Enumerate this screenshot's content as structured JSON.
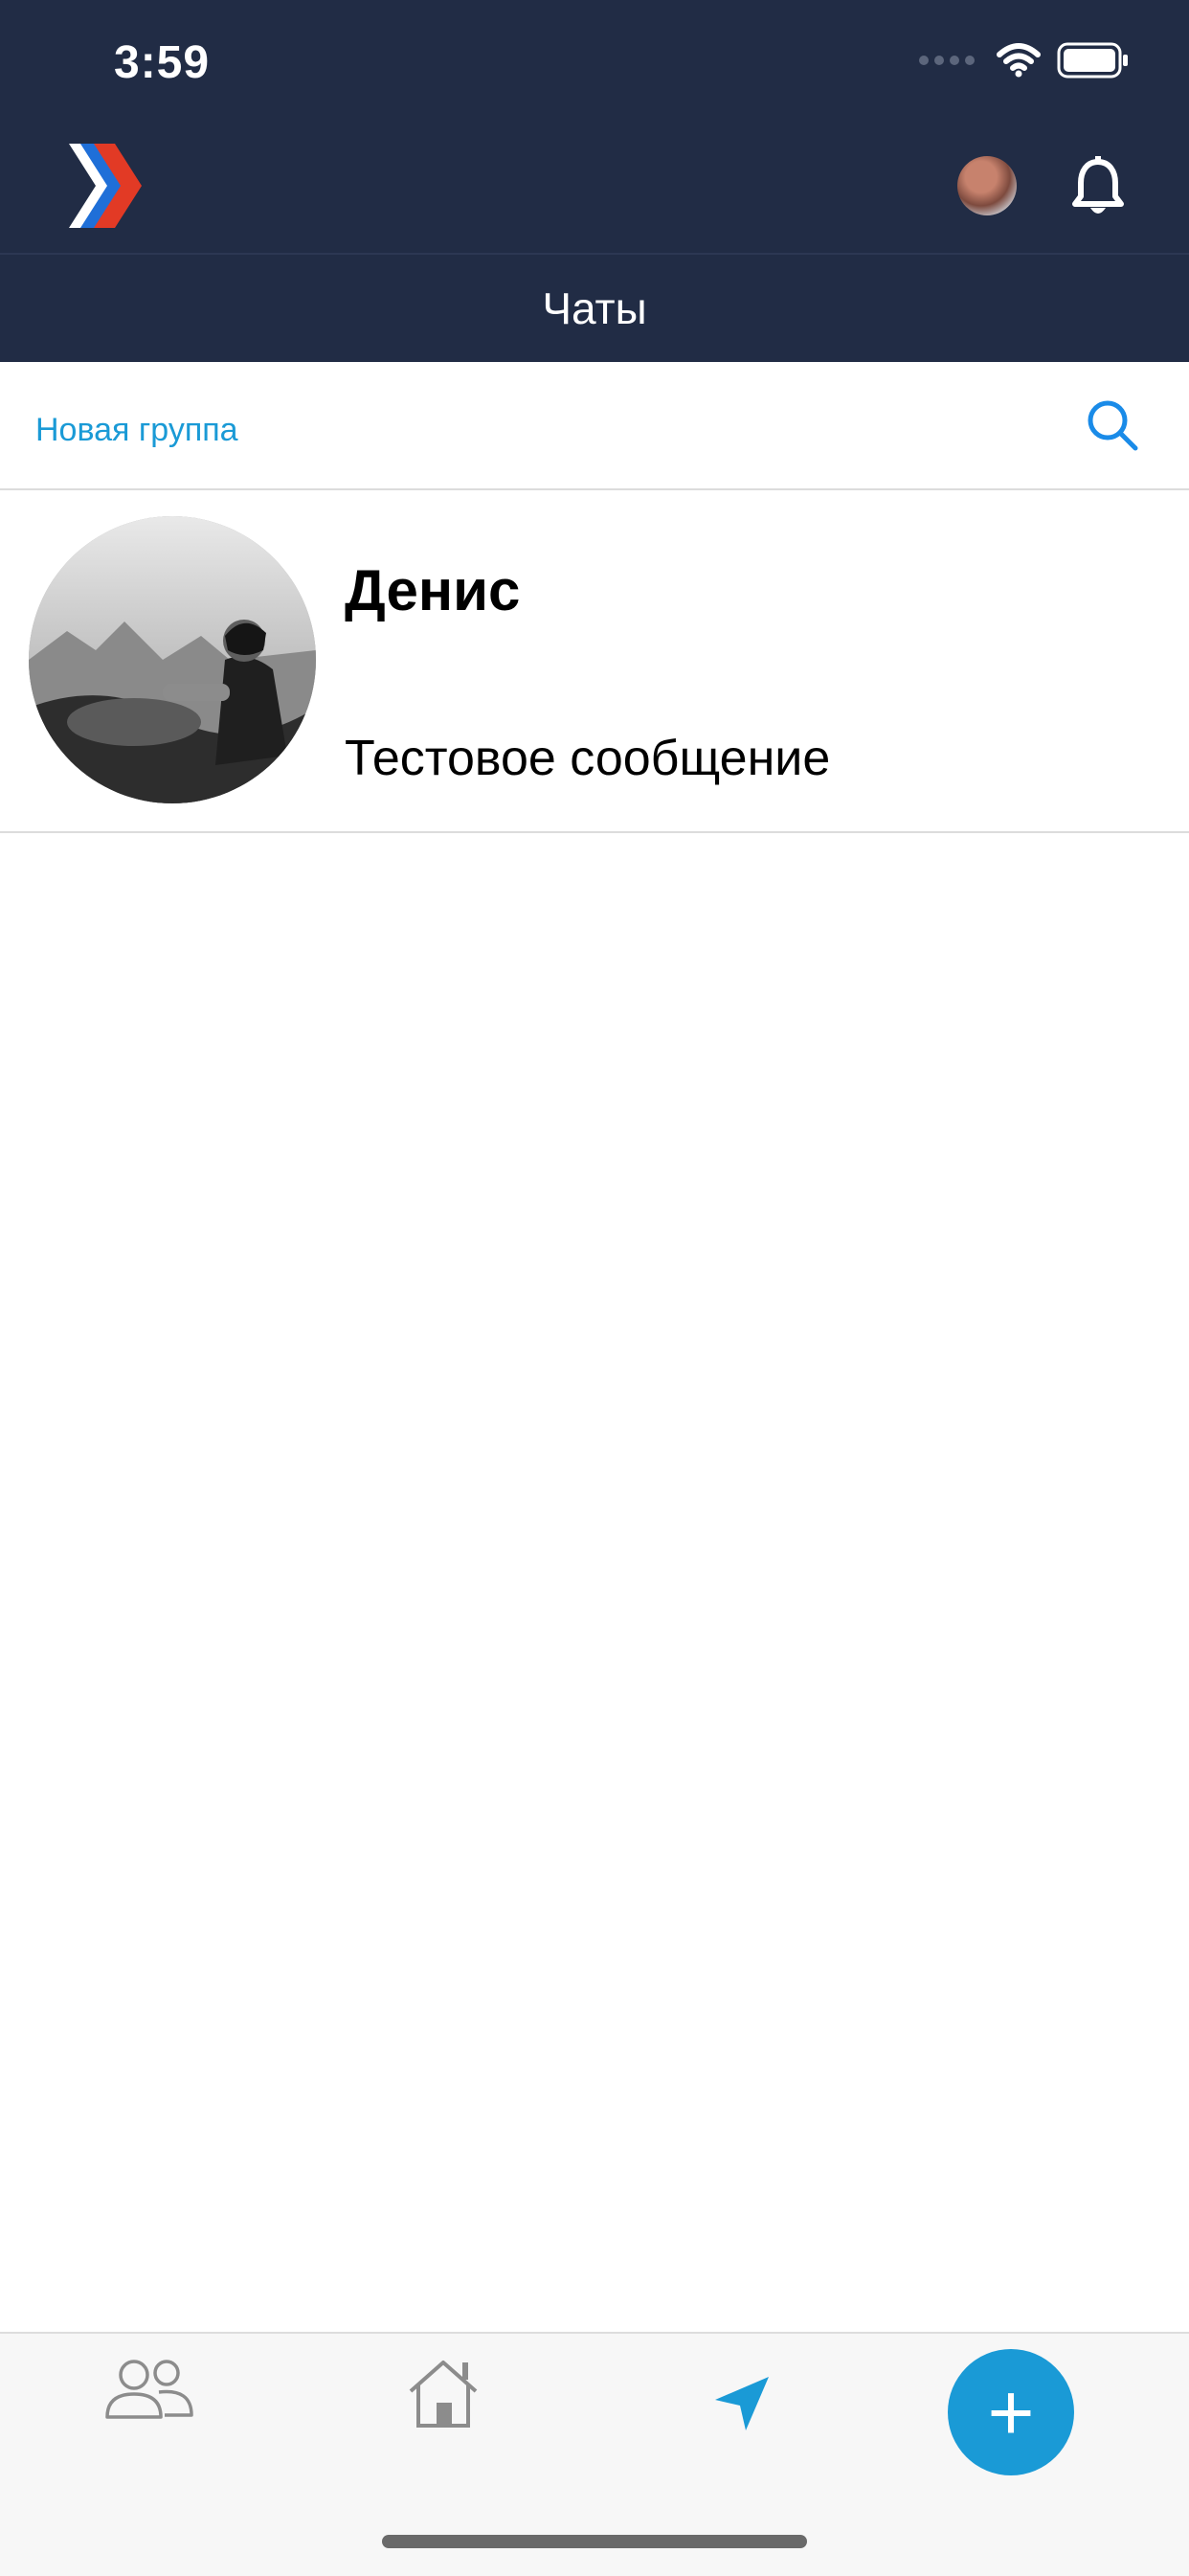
{
  "status_bar": {
    "time": "3:59"
  },
  "header": {
    "title": "Чаты",
    "logo_icon": "app-logo-chevrons",
    "profile_avatar_icon": "profile-avatar",
    "notifications_icon": "bell-icon"
  },
  "subheader": {
    "new_group_label": "Новая группа",
    "search_icon": "search-icon"
  },
  "chats": [
    {
      "name": "Денис",
      "last_message": "Тестовое сообщение",
      "avatar_icon": "contact-photo"
    }
  ],
  "tabbar": {
    "items": [
      {
        "icon": "people-icon",
        "active": false
      },
      {
        "icon": "home-icon",
        "active": false
      },
      {
        "icon": "send-icon",
        "active": true
      }
    ],
    "fab_label": "+",
    "fab_icon": "plus-icon"
  },
  "colors": {
    "header_bg": "#212c45",
    "accent": "#1a9ad6",
    "tabbar_bg": "#f7f7f7"
  }
}
